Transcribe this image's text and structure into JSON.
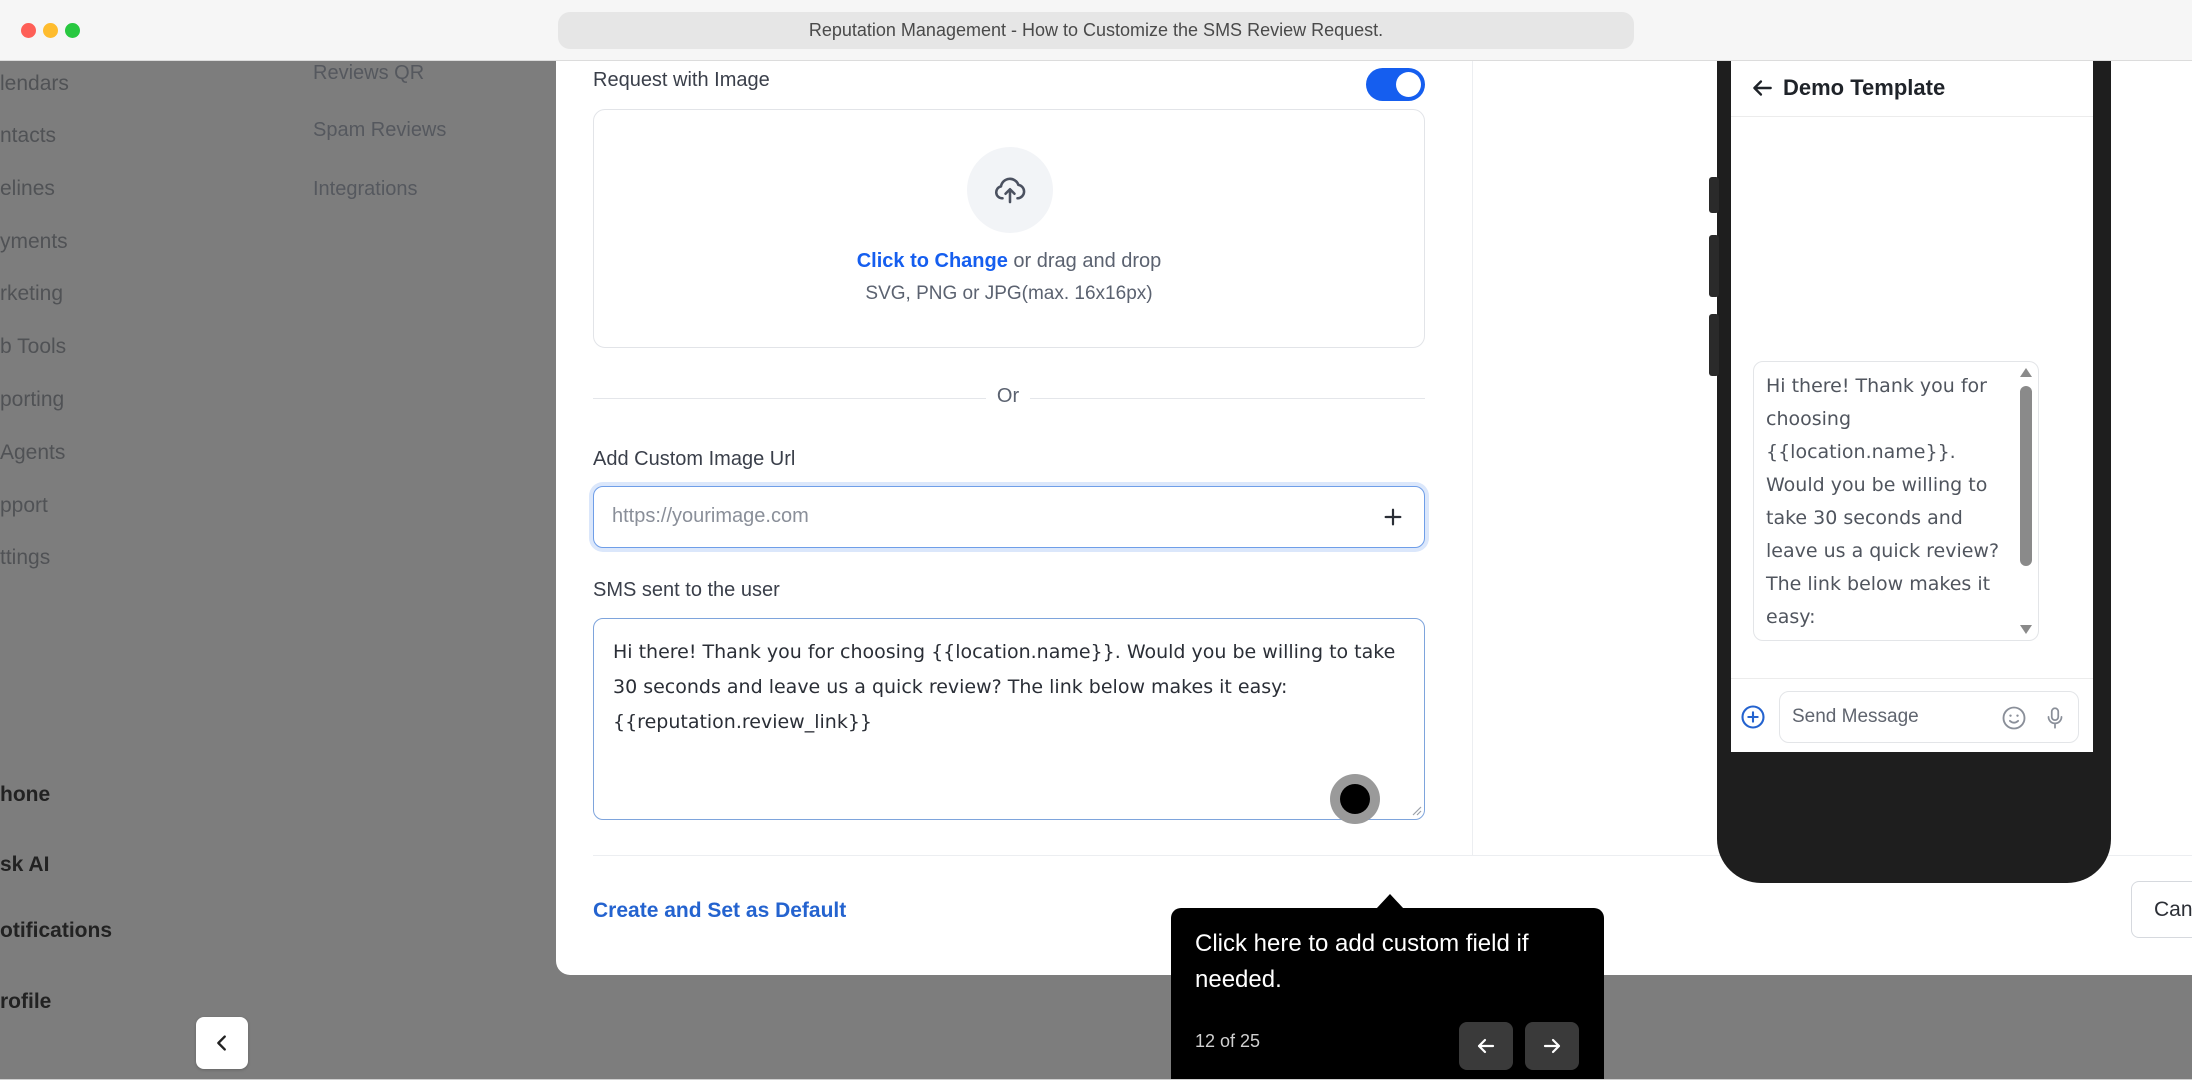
{
  "window": {
    "title": "Reputation Management - How to Customize the SMS Review Request."
  },
  "sidebar": {
    "items": [
      {
        "label": "lendars"
      },
      {
        "label": "ntacts"
      },
      {
        "label": "elines"
      },
      {
        "label": "yments"
      },
      {
        "label": "rketing"
      },
      {
        "label": "b Tools"
      },
      {
        "label": "porting"
      },
      {
        "label": "Agents"
      },
      {
        "label": "pport"
      },
      {
        "label": "ttings"
      }
    ],
    "bottom_items": [
      {
        "label": "hone"
      },
      {
        "label": "sk AI"
      },
      {
        "label": "otifications"
      },
      {
        "label": "rofile"
      }
    ]
  },
  "subnav": {
    "items": [
      {
        "label": "Reviews QR"
      },
      {
        "label": "Spam Reviews"
      },
      {
        "label": "Integrations"
      }
    ]
  },
  "form": {
    "request_with_image_label": "Request with Image",
    "request_with_image_enabled": true,
    "upload": {
      "link_text": "Click to Change",
      "rest_text": " or drag and drop",
      "hint": "SVG, PNG or JPG(max. 16x16px)"
    },
    "or_text": "Or",
    "custom_url_label": "Add Custom Image Url",
    "custom_url_placeholder": "https://yourimage.com",
    "custom_url_value": "",
    "sms_label": "SMS sent to the user",
    "sms_text": "Hi there! Thank you for choosing {{location.name}}. Would you be willing to take 30 seconds and leave us a quick review? The link below makes it easy: {{reputation.review_link}}",
    "create_default_label": "Create and Set as Default",
    "cancel_label": "Can"
  },
  "preview": {
    "title": "Demo Template",
    "bubble_text": "Hi there! Thank you for choosing {{location.name}}. Would you be willing to take 30 seconds and leave us a quick review? The link below makes it easy:",
    "message_placeholder": "Send Message"
  },
  "tour": {
    "text": "Click here to add custom field if needed.",
    "step": "12 of 25"
  },
  "colors": {
    "accent": "#155eef",
    "link": "#2463cf",
    "overlay": "#7d7d7d",
    "tooltip_bg": "#000000"
  },
  "icons": {
    "upload": "cloud-upload-icon",
    "plus": "plus-icon",
    "back": "arrow-left-icon",
    "emoji": "emoji-icon",
    "mic": "microphone-icon",
    "collapse": "chevron-left-icon"
  }
}
